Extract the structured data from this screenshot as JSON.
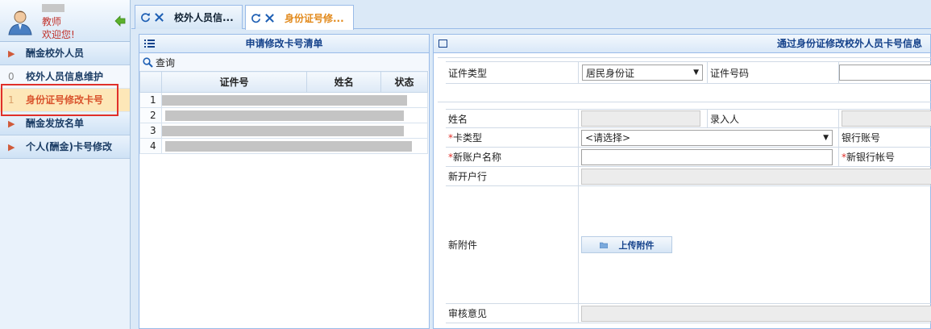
{
  "user": {
    "role": "教师",
    "welcome": "欢迎您!"
  },
  "sidebar": {
    "items": [
      {
        "type": "group",
        "label": "酬金校外人员",
        "caret": "▶"
      },
      {
        "type": "sub",
        "index": "0",
        "label": "校外人员信息维护"
      },
      {
        "type": "sub",
        "index": "1",
        "label": "身份证号修改卡号",
        "active": true
      },
      {
        "type": "group",
        "label": "酬金发放名单",
        "caret": "▶"
      },
      {
        "type": "group",
        "label": "个人(酬金)卡号修改",
        "caret": "▶"
      }
    ]
  },
  "tabs": [
    {
      "label": "校外人员信..."
    },
    {
      "label": "身份证号修...",
      "active": true
    }
  ],
  "left_panel": {
    "title": "申请修改卡号清单",
    "query_label": "查询",
    "columns": [
      "证件号",
      "姓名",
      "状态"
    ],
    "rows": [
      {
        "num": "1"
      },
      {
        "num": "2"
      },
      {
        "num": "3"
      },
      {
        "num": "4"
      }
    ]
  },
  "right_panel": {
    "title": "通过身份证修改校外人员卡号信息",
    "id_type_label": "证件类型",
    "id_type_value": "居民身份证",
    "id_number_label": "证件号码",
    "name_label": "姓名",
    "entered_by_label": "录入人",
    "card_type_label": "卡类型",
    "card_type_value": "<请选择>",
    "bank_account_label": "银行账号",
    "new_account_name_label": "新账户名称",
    "new_bank_account_label": "新银行帐号",
    "new_bank_branch_label": "新开户行",
    "new_attachment_label": "新附件",
    "upload_label": "上传附件",
    "review_label": "审核意见",
    "required_mark": "*"
  }
}
